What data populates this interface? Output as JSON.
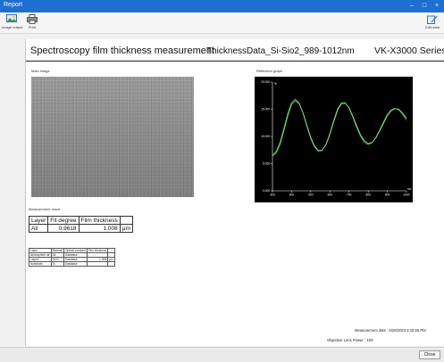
{
  "window": {
    "title": "Report"
  },
  "toolbar": {
    "items": [
      {
        "label": "Image output"
      },
      {
        "label": "Print"
      },
      {
        "label": "Edit data"
      }
    ]
  },
  "report": {
    "title": "Spectroscopy film thickness measurement",
    "filename": "ThicknessData_Si-Sio2_989-1012nm",
    "model": "VK-X3000 Series",
    "main_image_label": "Main image",
    "graph_label": "Reflection graph",
    "result_label": "Measurement result",
    "result_table": {
      "headers": [
        "Layer",
        "Fit degree",
        "Film thickness",
        ""
      ],
      "rows": [
        [
          "All",
          "0.9618",
          "1.008",
          "μm"
        ]
      ]
    },
    "layer_table": {
      "headers": [
        "Layer",
        "Material",
        "Optical constant",
        "Film thickness",
        ""
      ],
      "rows": [
        [
          "Atmosphere air",
          "Air",
          "Database",
          "",
          ""
        ],
        [
          "Layer1",
          "SiO2",
          "Database",
          "1.008",
          "μm"
        ],
        [
          "Substrate",
          "Si",
          "Database",
          "",
          ""
        ]
      ]
    },
    "footer": {
      "date_label": "Measurement date :",
      "date_value": "6/29/2023 2:10:55 PM",
      "lens_label": "Objective Lens Power :",
      "lens_value": "10X"
    }
  },
  "buttons": {
    "close": "Close"
  },
  "colors": {
    "titlebar": "#1e6fd0",
    "graph_bg": "#000000",
    "curve_a": "#2fbf3a",
    "curve_b": "#a9e4a6"
  },
  "chart_data": {
    "type": "line",
    "x": [
      300,
      320,
      340,
      360,
      380,
      400,
      420,
      440,
      460,
      480,
      500,
      520,
      540,
      560,
      580,
      600,
      620,
      640,
      660,
      680,
      700,
      720,
      740,
      760,
      780,
      800,
      820,
      840,
      860,
      880,
      900,
      920,
      940,
      960,
      980,
      1000
    ],
    "series": [
      {
        "values": [
          6.6,
          7.3,
          9.0,
          11.6,
          14.3,
          16.3,
          16.9,
          16.1,
          14.2,
          11.8,
          9.6,
          8.0,
          7.2,
          7.4,
          8.6,
          10.6,
          13.0,
          15.1,
          16.2,
          16.2,
          15.2,
          13.5,
          11.6,
          10.0,
          8.9,
          8.5,
          8.8,
          9.8,
          11.2,
          12.7,
          14.1,
          14.9,
          15.2,
          14.9,
          14.0,
          13.0
        ]
      },
      {
        "values": [
          6.4,
          7.0,
          8.6,
          11.1,
          13.8,
          15.9,
          16.6,
          16.0,
          14.3,
          12.0,
          9.8,
          8.2,
          7.4,
          7.5,
          8.5,
          10.4,
          12.7,
          14.8,
          16.0,
          16.1,
          15.3,
          13.7,
          11.9,
          10.3,
          9.2,
          8.7,
          8.9,
          9.7,
          11.0,
          12.4,
          13.8,
          14.7,
          15.1,
          15.0,
          14.3,
          13.3
        ]
      }
    ],
    "xlim": [
      300,
      1000
    ],
    "ylim": [
      0,
      20
    ],
    "xticks": [
      300,
      400,
      500,
      600,
      700,
      800,
      900,
      1000
    ],
    "yticks": [
      0,
      5,
      10,
      15,
      20
    ],
    "xtick_labels": [
      "300",
      "400",
      "500",
      "600",
      "700",
      "800",
      "900",
      "1000"
    ],
    "ytick_labels": [
      "0.000",
      "5.000",
      "10.000",
      "15.000",
      "20.000"
    ],
    "ylabel": "%",
    "xlabel": "nm",
    "grid": false
  }
}
